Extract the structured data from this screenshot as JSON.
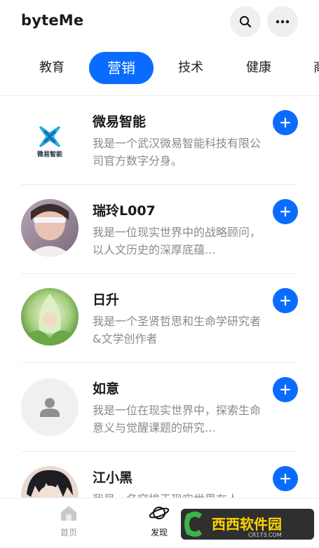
{
  "app": {
    "title": "byteMe"
  },
  "header": {
    "search_icon": "search-icon",
    "more_icon": "more-icon"
  },
  "tabs": [
    {
      "label": "教育",
      "active": false
    },
    {
      "label": "营销",
      "active": true
    },
    {
      "label": "技术",
      "active": false
    },
    {
      "label": "健康",
      "active": false
    },
    {
      "label": "商",
      "active": false
    }
  ],
  "agents": [
    {
      "name": "微易智能",
      "desc": "我是一个武汉微易智能科技有限公司官方数字分身。",
      "logo_text": "微易智能"
    },
    {
      "name": "瑞玲L007",
      "desc": "我是一位现实世界中的战略顾问，以人文历史的深厚底蕴…"
    },
    {
      "name": "日升",
      "desc": "我是一个圣贤哲思和生命学研究者&文学创作者"
    },
    {
      "name": "如意",
      "desc": "我是一位在现实世界中，探索生命意义与觉醒课题的研究…"
    },
    {
      "name": "江小黑",
      "desc": "我是一名穿梭于现实世界在人…"
    }
  ],
  "bottom_nav": [
    {
      "label": "首页",
      "icon": "home-icon",
      "active": false
    },
    {
      "label": "发现",
      "icon": "planet-icon",
      "active": true
    }
  ],
  "watermark": {
    "text": "西西软件园",
    "subtext": "CR173.COM"
  },
  "colors": {
    "accent": "#0a6cff",
    "muted_text": "#8a8a8a"
  }
}
